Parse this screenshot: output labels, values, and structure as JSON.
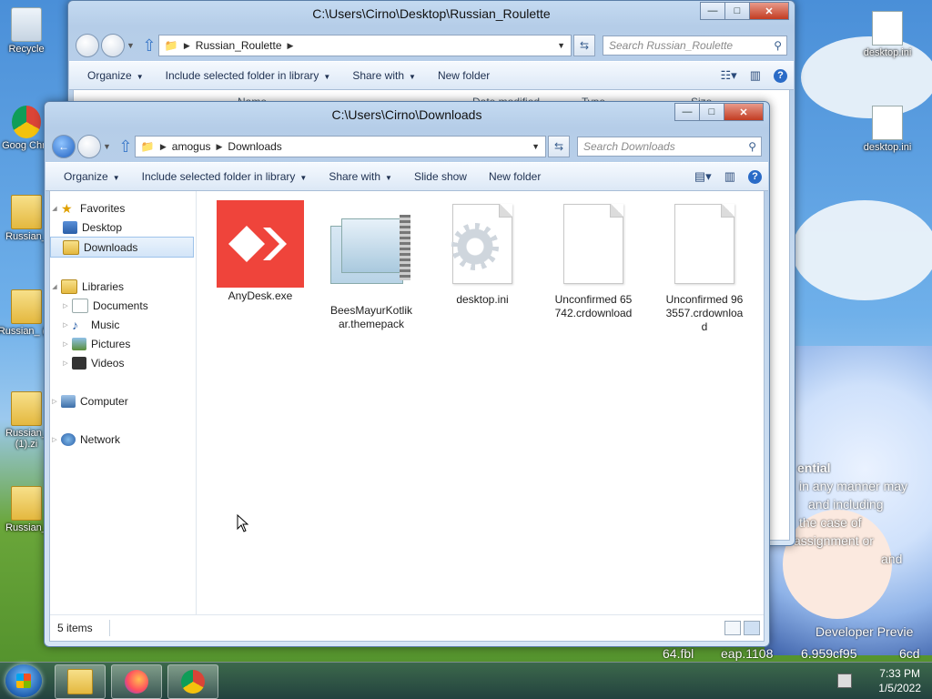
{
  "desktop": {
    "left_icons": [
      {
        "label": "Recycle"
      },
      {
        "label": "Goog Chro"
      },
      {
        "label": "Russian_"
      },
      {
        "label": "Russian_ (1)"
      },
      {
        "label": "Russian_ (1).zi"
      },
      {
        "label": "Russian_"
      }
    ],
    "right_icons": [
      {
        "label": "desktop.ini"
      },
      {
        "label": "desktop.ini"
      }
    ],
    "wallpaper_text": [
      "ential",
      "in any manner may",
      "and including",
      "the case of",
      "assignment or",
      "and",
      "Developer Previe",
      "64.fbl",
      "eap.1108",
      "6.959cf95",
      "6cd"
    ]
  },
  "back_window": {
    "title": "C:\\Users\\Cirno\\Desktop\\Russian_Roulette",
    "breadcrumb": [
      "Russian_Roulette"
    ],
    "search_placeholder": "Search Russian_Roulette",
    "commands": [
      "Organize",
      "Include selected folder in library",
      "Share with",
      "New folder"
    ],
    "columns": [
      "Name",
      "Date modified",
      "Type",
      "Size"
    ]
  },
  "window": {
    "title": "C:\\Users\\Cirno\\Downloads",
    "caption": {
      "minimize": "—",
      "maximize": "□",
      "close": "✕"
    },
    "breadcrumb": [
      "amogus",
      "Downloads"
    ],
    "search_placeholder": "Search Downloads",
    "commands": [
      "Organize",
      "Include selected folder in library",
      "Share with",
      "Slide show",
      "New folder"
    ],
    "nav_tree": {
      "favorites": "Favorites",
      "favorites_items": [
        "Desktop",
        "Downloads"
      ],
      "libraries": "Libraries",
      "libraries_items": [
        "Documents",
        "Music",
        "Pictures",
        "Videos"
      ],
      "computer": "Computer",
      "network": "Network"
    },
    "files": [
      {
        "name": "AnyDesk.exe",
        "icon": "anydesk-icon"
      },
      {
        "name": "BeesMayurKotlikar.themepack",
        "icon": "themepack-icon"
      },
      {
        "name": "desktop.ini",
        "icon": "settings-file-icon"
      },
      {
        "name": "Unconfirmed 65742.crdownload",
        "icon": "blank-file-icon"
      },
      {
        "name": "Unconfirmed 963557.crdownload",
        "icon": "blank-file-icon"
      }
    ],
    "status": "5 items"
  },
  "taskbar": {
    "time": "7:33 PM",
    "date": "1/5/2022",
    "pinned": [
      "explorer-icon",
      "firefox-icon",
      "chrome-icon"
    ]
  },
  "colors": {
    "anydesk": "#ef443b",
    "selection": "#d3e5f8",
    "accent": "#2a6bc7"
  }
}
